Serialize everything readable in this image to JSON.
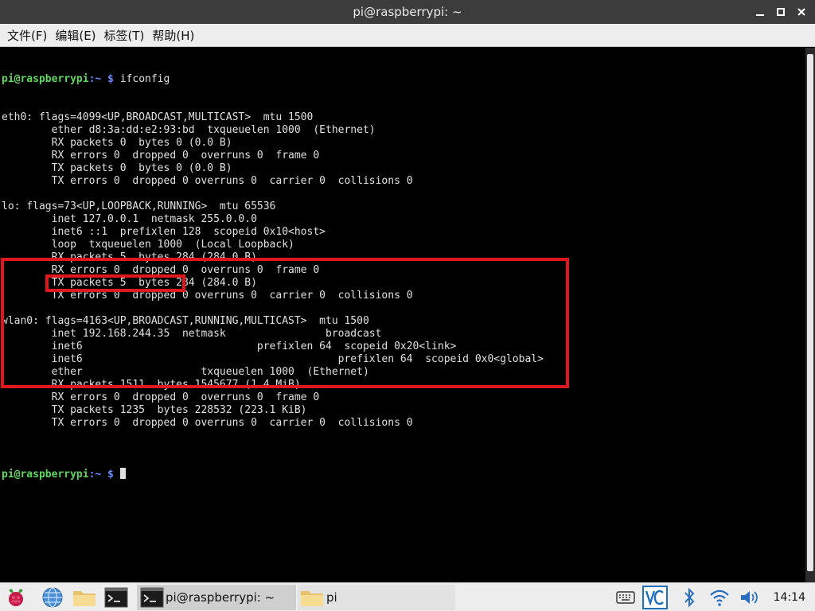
{
  "window": {
    "title": "pi@raspberrypi: ~"
  },
  "menu": [
    "文件(F)",
    "编辑(E)",
    "标签(T)",
    "帮助(H)"
  ],
  "terminal": {
    "prompt_user": "pi@raspberrypi",
    "prompt_path": ":~ $",
    "command": "ifconfig",
    "output": [
      "eth0: flags=4099<UP,BROADCAST,MULTICAST>  mtu 1500",
      "        ether d8:3a:dd:e2:93:bd  txqueuelen 1000  (Ethernet)",
      "        RX packets 0  bytes 0 (0.0 B)",
      "        RX errors 0  dropped 0  overruns 0  frame 0",
      "        TX packets 0  bytes 0 (0.0 B)",
      "        TX errors 0  dropped 0 overruns 0  carrier 0  collisions 0",
      "",
      "lo: flags=73<UP,LOOPBACK,RUNNING>  mtu 65536",
      "        inet 127.0.0.1  netmask 255.0.0.0",
      "        inet6 ::1  prefixlen 128  scopeid 0x10<host>",
      "        loop  txqueuelen 1000  (Local Loopback)",
      "        RX packets 5  bytes 284 (284.0 B)",
      "        RX errors 0  dropped 0  overruns 0  frame 0",
      "        TX packets 5  bytes 284 (284.0 B)",
      "        TX errors 0  dropped 0 overruns 0  carrier 0  collisions 0",
      "",
      "wlan0: flags=4163<UP,BROADCAST,RUNNING,MULTICAST>  mtu 1500",
      "        inet 192.168.244.35  netmask                broadcast",
      "        inet6                            prefixlen 64  scopeid 0x20<link>",
      "        inet6                                         prefixlen 64  scopeid 0x0<global>",
      "        ether                   txqueuelen 1000  (Ethernet)",
      "        RX packets 1511  bytes 1545677 (1.4 MiB)",
      "        RX errors 0  dropped 0  overruns 0  frame 0",
      "        TX packets 1235  bytes 228532 (223.1 KiB)",
      "        TX errors 0  dropped 0 overruns 0  carrier 0  collisions 0",
      ""
    ]
  },
  "taskbar": {
    "tasks": [
      {
        "label": "pi@raspberrypi: ~"
      },
      {
        "label": "pi"
      }
    ],
    "clock": "14:14"
  },
  "colors": {
    "highlight": "#e0171c",
    "prompt_user": "#5fd75f",
    "prompt_path": "#6c8cff"
  }
}
